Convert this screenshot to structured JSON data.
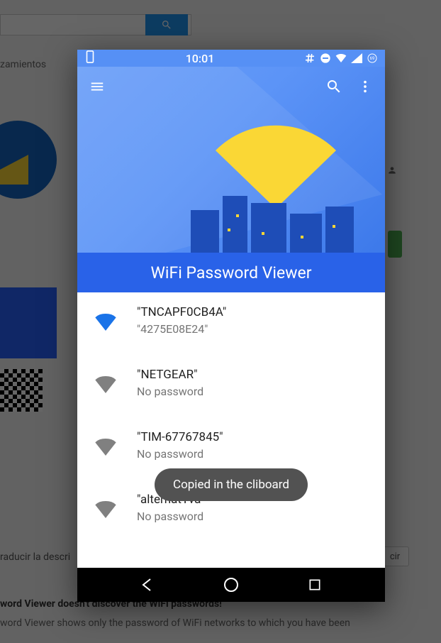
{
  "background": {
    "nav_tab": "zamientos",
    "translate_text": "raducir la descri",
    "review_btn": "cir",
    "desc_bold": "word Viewer doesn't discover the WiFi passwords!",
    "desc_line2": "word Viewer shows only the password of WiFi networks to which you have been"
  },
  "status_bar": {
    "time": "10:01"
  },
  "app": {
    "title": "WiFi Password Viewer"
  },
  "networks": [
    {
      "ssid": "\"TNCAPF0CB4A\"",
      "password": "\"4275E08E24\"",
      "active": true
    },
    {
      "ssid": "\"NETGEAR\"",
      "password": "No password",
      "active": false
    },
    {
      "ssid": "\"TIM-67767845\"",
      "password": "No password",
      "active": false
    },
    {
      "ssid": "\"alternatYva\"",
      "password": "No password",
      "active": false
    }
  ],
  "toast": {
    "message": "Copied in the cliboard"
  }
}
